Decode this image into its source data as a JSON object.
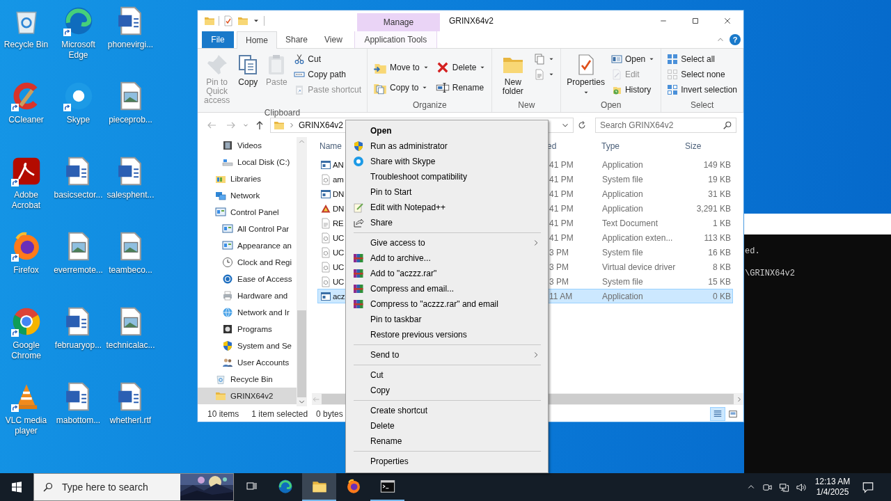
{
  "desktop": {
    "icons": [
      {
        "label": "Recycle Bin",
        "shortcut": false
      },
      {
        "label": "Microsoft Edge",
        "shortcut": true
      },
      {
        "label": "phonevirgi...",
        "shortcut": false
      },
      {
        "label": "CCleaner",
        "shortcut": true
      },
      {
        "label": "Skype",
        "shortcut": true
      },
      {
        "label": "pieceprob...",
        "shortcut": false
      },
      {
        "label": "Adobe Acrobat",
        "shortcut": true
      },
      {
        "label": "basicsector...",
        "shortcut": false
      },
      {
        "label": "salesphent...",
        "shortcut": false
      },
      {
        "label": "Firefox",
        "shortcut": true
      },
      {
        "label": "everremote...",
        "shortcut": false
      },
      {
        "label": "teambeco...",
        "shortcut": false
      },
      {
        "label": "Google Chrome",
        "shortcut": true
      },
      {
        "label": "februaryop...",
        "shortcut": false
      },
      {
        "label": "technicalac...",
        "shortcut": false
      },
      {
        "label": "VLC media player",
        "shortcut": true
      },
      {
        "label": "mabottom...",
        "shortcut": false
      },
      {
        "label": "whetherl.rtf",
        "shortcut": false
      }
    ]
  },
  "console": {
    "lines": [
      "ed.",
      "\\GRINX64v2"
    ]
  },
  "explorer": {
    "title": "GRINX64v2",
    "context_tab_header": "Manage",
    "help": "?",
    "tabs": [
      {
        "label": "File",
        "kind": "file",
        "selected": false
      },
      {
        "label": "Home",
        "kind": "tab",
        "selected": true
      },
      {
        "label": "Share",
        "kind": "tab",
        "selected": false
      },
      {
        "label": "View",
        "kind": "tab",
        "selected": false
      },
      {
        "label": "Application Tools",
        "kind": "context",
        "selected": false
      }
    ],
    "ribbon": {
      "groups": [
        {
          "label": "Clipboard",
          "buttons": [
            {
              "kind": "large",
              "label": "Pin to Quick access",
              "disabled": true,
              "dropdown": false
            },
            {
              "kind": "large",
              "label": "Copy",
              "disabled": false,
              "dropdown": false
            },
            {
              "kind": "large",
              "label": "Paste",
              "disabled": true,
              "dropdown": false
            },
            {
              "kind": "small",
              "label": "Cut",
              "disabled": false,
              "dropdown": false
            },
            {
              "kind": "small",
              "label": "Copy path",
              "disabled": false,
              "dropdown": false
            },
            {
              "kind": "small",
              "label": "Paste shortcut",
              "disabled": true,
              "dropdown": false
            }
          ]
        },
        {
          "label": "Organize",
          "buttons": [
            {
              "kind": "medium",
              "label": "Move to",
              "disabled": false,
              "dropdown": true
            },
            {
              "kind": "medium",
              "label": "Copy to",
              "disabled": false,
              "dropdown": true
            },
            {
              "kind": "medium",
              "label": "Delete",
              "disabled": false,
              "dropdown": true
            },
            {
              "kind": "medium",
              "label": "Rename",
              "disabled": false,
              "dropdown": false
            }
          ]
        },
        {
          "label": "New",
          "buttons": [
            {
              "kind": "large",
              "label": "New folder",
              "disabled": false,
              "dropdown": false
            },
            {
              "kind": "small",
              "disabled": false,
              "dropdown": true
            },
            {
              "kind": "small",
              "disabled": false,
              "dropdown": true
            }
          ]
        },
        {
          "label": "Open",
          "buttons": [
            {
              "kind": "large",
              "label": "Properties",
              "disabled": false,
              "dropdown": true
            },
            {
              "kind": "small",
              "label": "Open",
              "disabled": false,
              "dropdown": true
            },
            {
              "kind": "small",
              "label": "Edit",
              "disabled": true,
              "dropdown": false
            },
            {
              "kind": "small",
              "label": "History",
              "disabled": false,
              "dropdown": false
            }
          ]
        },
        {
          "label": "Select",
          "buttons": [
            {
              "kind": "small",
              "label": "Select all",
              "disabled": false,
              "dropdown": false
            },
            {
              "kind": "small",
              "label": "Select none",
              "disabled": false,
              "dropdown": false
            },
            {
              "kind": "small",
              "label": "Invert selection",
              "disabled": false,
              "dropdown": false
            }
          ]
        }
      ]
    },
    "address": {
      "path": "GRINX64v2",
      "search_placeholder": "Search GRINX64v2"
    },
    "nav_pane": {
      "children_of_scrolled_item": [
        {
          "label": "Videos",
          "selected": false
        },
        {
          "label": "Local Disk (C:)",
          "selected": false
        }
      ],
      "items": [
        {
          "label": "Libraries",
          "selected": false
        },
        {
          "label": "Network",
          "selected": false
        },
        {
          "label": "Control Panel",
          "selected": false,
          "children": [
            {
              "label": "All Control Par",
              "selected": false
            },
            {
              "label": "Appearance an",
              "selected": false
            },
            {
              "label": "Clock and Regi",
              "selected": false
            },
            {
              "label": "Ease of Access",
              "selected": false
            },
            {
              "label": "Hardware and",
              "selected": false
            },
            {
              "label": "Network and Ir",
              "selected": false
            },
            {
              "label": "Programs",
              "selected": false
            },
            {
              "label": "System and Se",
              "selected": false
            },
            {
              "label": "User Accounts",
              "selected": false
            }
          ]
        },
        {
          "label": "Recycle Bin",
          "selected": false
        },
        {
          "label": "GRINX64v2",
          "selected": true
        }
      ]
    },
    "files": {
      "columns": [
        "Name",
        "ed",
        "Type",
        "Size"
      ],
      "rows": [
        {
          "name": "AN",
          "date": "41 PM",
          "type": "Application",
          "size": "149 KB",
          "selected": false
        },
        {
          "name": "am",
          "date": "41 PM",
          "type": "System file",
          "size": "19 KB",
          "selected": false
        },
        {
          "name": "DN",
          "date": "41 PM",
          "type": "Application",
          "size": "31 KB",
          "selected": false
        },
        {
          "name": "DN",
          "date": "41 PM",
          "type": "Application",
          "size": "3,291 KB",
          "selected": false
        },
        {
          "name": "RE",
          "date": "41 PM",
          "type": "Text Document",
          "size": "1 KB",
          "selected": false
        },
        {
          "name": "UC",
          "date": "41 PM",
          "type": "Application exten...",
          "size": "113 KB",
          "selected": false
        },
        {
          "name": "UC",
          "date": "3 PM",
          "type": "System file",
          "size": "16 KB",
          "selected": false
        },
        {
          "name": "UC",
          "date": "3 PM",
          "type": "Virtual device driver",
          "size": "8 KB",
          "selected": false
        },
        {
          "name": "UC",
          "date": "3 PM",
          "type": "System file",
          "size": "15 KB",
          "selected": false
        },
        {
          "name": "acz",
          "date": "11 AM",
          "type": "Application",
          "size": "0 KB",
          "selected": true
        }
      ]
    },
    "status": {
      "item_count": "10 items",
      "selection": "1 item selected",
      "selection_size": "0 bytes",
      "views": [
        {
          "kind": "details",
          "selected": true
        },
        {
          "kind": "large_icons",
          "selected": false
        }
      ]
    }
  },
  "context_menu": {
    "items": [
      {
        "kind": "item",
        "label": "Open",
        "default": true
      },
      {
        "kind": "item",
        "label": "Run as administrator"
      },
      {
        "kind": "item",
        "label": "Share with Skype"
      },
      {
        "kind": "item",
        "label": "Troubleshoot compatibility"
      },
      {
        "kind": "item",
        "label": "Pin to Start"
      },
      {
        "kind": "item",
        "label": "Edit with Notepad++"
      },
      {
        "kind": "item",
        "label": "Share"
      },
      {
        "kind": "separator"
      },
      {
        "kind": "submenu",
        "label": "Give access to"
      },
      {
        "kind": "item",
        "label": "Add to archive..."
      },
      {
        "kind": "item",
        "label": "Add to \"aczzz.rar\""
      },
      {
        "kind": "item",
        "label": "Compress and email..."
      },
      {
        "kind": "item",
        "label": "Compress to \"aczzz.rar\" and email"
      },
      {
        "kind": "item",
        "label": "Pin to taskbar"
      },
      {
        "kind": "item",
        "label": "Restore previous versions"
      },
      {
        "kind": "separator"
      },
      {
        "kind": "submenu",
        "label": "Send to"
      },
      {
        "kind": "separator"
      },
      {
        "kind": "item",
        "label": "Cut"
      },
      {
        "kind": "item",
        "label": "Copy"
      },
      {
        "kind": "separator"
      },
      {
        "kind": "item",
        "label": "Create shortcut"
      },
      {
        "kind": "item",
        "label": "Delete"
      },
      {
        "kind": "item",
        "label": "Rename"
      },
      {
        "kind": "separator"
      },
      {
        "kind": "item",
        "label": "Properties"
      }
    ]
  },
  "taskbar": {
    "search_placeholder": "Type here to search",
    "apps": [
      {
        "kind": "edge",
        "running": false,
        "selected": false
      },
      {
        "kind": "explorer",
        "running": true,
        "selected": true
      },
      {
        "kind": "firefox",
        "running": false,
        "selected": false
      },
      {
        "kind": "terminal",
        "running": true,
        "selected": false
      }
    ],
    "clock": {
      "time": "12:13 AM",
      "date": "1/4/2025"
    }
  }
}
